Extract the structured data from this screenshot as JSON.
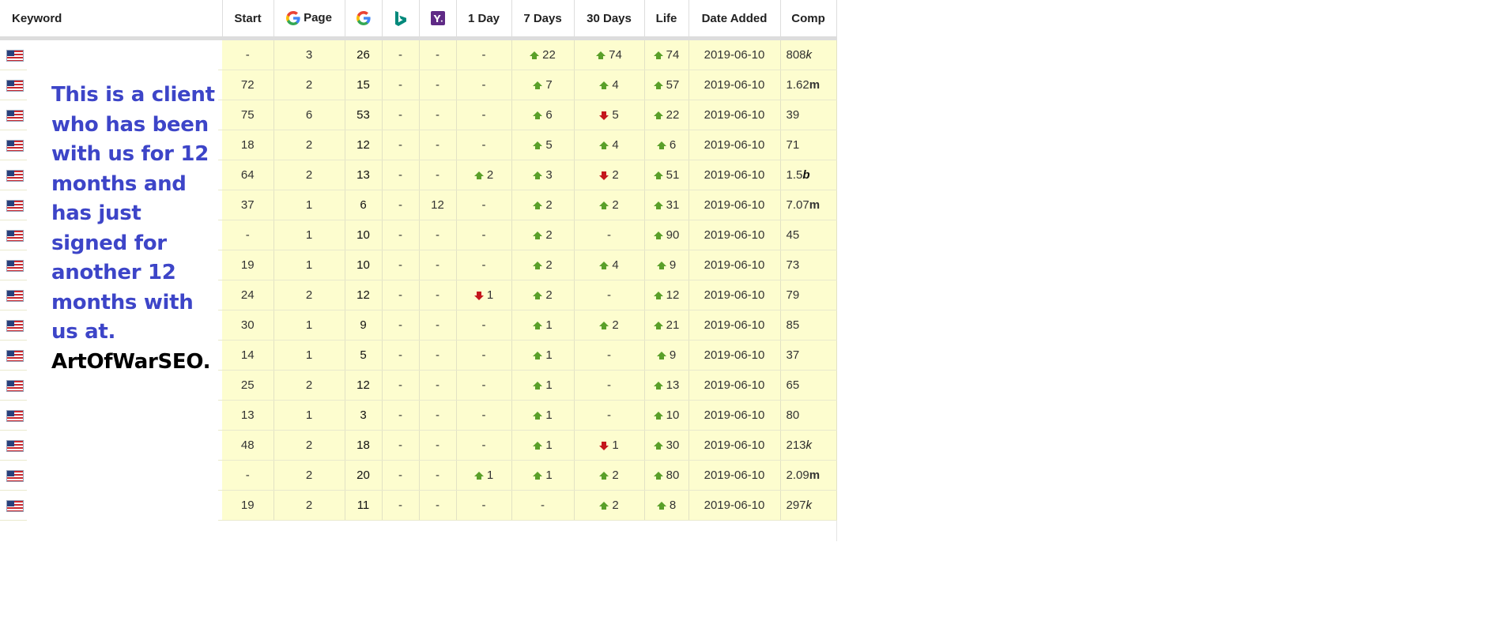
{
  "header": {
    "keyword": "Keyword",
    "start": "Start",
    "page": "Page",
    "day1": "1 Day",
    "days7": "7 Days",
    "days30": "30 Days",
    "life": "Life",
    "date_added": "Date Added",
    "comp": "Comp",
    "google_icon": "google-icon",
    "bing_icon": "bing-icon",
    "yahoo_icon": "yahoo-icon"
  },
  "colors": {
    "row_bg": "#fdfdcf",
    "up_arrow": "#5aa029",
    "down_arrow": "#c4161c",
    "note_text": "#3d45c8"
  },
  "rows": [
    {
      "start": "-",
      "page": "3",
      "google": "26",
      "bing": "-",
      "yahoo": "-",
      "d1": "",
      "d1_dir": "",
      "d7": "22",
      "d7_dir": "up",
      "d30": "74",
      "d30_dir": "up",
      "life": "74",
      "life_dir": "up",
      "date": "2019-06-10",
      "comp": "808",
      "comp_suffix": "k"
    },
    {
      "start": "72",
      "page": "2",
      "google": "15",
      "bing": "-",
      "yahoo": "-",
      "d1": "",
      "d1_dir": "",
      "d7": "7",
      "d7_dir": "up",
      "d30": "4",
      "d30_dir": "up",
      "life": "57",
      "life_dir": "up",
      "date": "2019-06-10",
      "comp": "1.62",
      "comp_suffix": "m"
    },
    {
      "start": "75",
      "page": "6",
      "google": "53",
      "bing": "-",
      "yahoo": "-",
      "d1": "",
      "d1_dir": "",
      "d7": "6",
      "d7_dir": "up",
      "d30": "5",
      "d30_dir": "down",
      "life": "22",
      "life_dir": "up",
      "date": "2019-06-10",
      "comp": "39",
      "comp_suffix": ""
    },
    {
      "start": "18",
      "page": "2",
      "google": "12",
      "bing": "-",
      "yahoo": "-",
      "d1": "",
      "d1_dir": "",
      "d7": "5",
      "d7_dir": "up",
      "d30": "4",
      "d30_dir": "up",
      "life": "6",
      "life_dir": "up",
      "date": "2019-06-10",
      "comp": "71",
      "comp_suffix": ""
    },
    {
      "start": "64",
      "page": "2",
      "google": "13",
      "bing": "-",
      "yahoo": "-",
      "d1": "2",
      "d1_dir": "up",
      "d7": "3",
      "d7_dir": "up",
      "d30": "2",
      "d30_dir": "down",
      "life": "51",
      "life_dir": "up",
      "date": "2019-06-10",
      "comp": "1.5",
      "comp_suffix": "b"
    },
    {
      "start": "37",
      "page": "1",
      "google": "6",
      "bing": "-",
      "yahoo": "12",
      "d1": "",
      "d1_dir": "",
      "d7": "2",
      "d7_dir": "up",
      "d30": "2",
      "d30_dir": "up",
      "life": "31",
      "life_dir": "up",
      "date": "2019-06-10",
      "comp": "7.07",
      "comp_suffix": "m"
    },
    {
      "start": "-",
      "page": "1",
      "google": "10",
      "bing": "-",
      "yahoo": "-",
      "d1": "",
      "d1_dir": "",
      "d7": "2",
      "d7_dir": "up",
      "d30": "",
      "d30_dir": "",
      "life": "90",
      "life_dir": "up",
      "date": "2019-06-10",
      "comp": "45",
      "comp_suffix": ""
    },
    {
      "start": "19",
      "page": "1",
      "google": "10",
      "bing": "-",
      "yahoo": "-",
      "d1": "",
      "d1_dir": "",
      "d7": "2",
      "d7_dir": "up",
      "d30": "4",
      "d30_dir": "up",
      "life": "9",
      "life_dir": "up",
      "date": "2019-06-10",
      "comp": "73",
      "comp_suffix": ""
    },
    {
      "start": "24",
      "page": "2",
      "google": "12",
      "bing": "-",
      "yahoo": "-",
      "d1": "1",
      "d1_dir": "down",
      "d7": "2",
      "d7_dir": "up",
      "d30": "",
      "d30_dir": "",
      "life": "12",
      "life_dir": "up",
      "date": "2019-06-10",
      "comp": "79",
      "comp_suffix": ""
    },
    {
      "start": "30",
      "page": "1",
      "google": "9",
      "bing": "-",
      "yahoo": "-",
      "d1": "",
      "d1_dir": "",
      "d7": "1",
      "d7_dir": "up",
      "d30": "2",
      "d30_dir": "up",
      "life": "21",
      "life_dir": "up",
      "date": "2019-06-10",
      "comp": "85",
      "comp_suffix": ""
    },
    {
      "start": "14",
      "page": "1",
      "google": "5",
      "bing": "-",
      "yahoo": "-",
      "d1": "",
      "d1_dir": "",
      "d7": "1",
      "d7_dir": "up",
      "d30": "",
      "d30_dir": "",
      "life": "9",
      "life_dir": "up",
      "date": "2019-06-10",
      "comp": "37",
      "comp_suffix": ""
    },
    {
      "start": "25",
      "page": "2",
      "google": "12",
      "bing": "-",
      "yahoo": "-",
      "d1": "",
      "d1_dir": "",
      "d7": "1",
      "d7_dir": "up",
      "d30": "",
      "d30_dir": "",
      "life": "13",
      "life_dir": "up",
      "date": "2019-06-10",
      "comp": "65",
      "comp_suffix": ""
    },
    {
      "start": "13",
      "page": "1",
      "google": "3",
      "bing": "-",
      "yahoo": "-",
      "d1": "",
      "d1_dir": "",
      "d7": "1",
      "d7_dir": "up",
      "d30": "",
      "d30_dir": "",
      "life": "10",
      "life_dir": "up",
      "date": "2019-06-10",
      "comp": "80",
      "comp_suffix": ""
    },
    {
      "start": "48",
      "page": "2",
      "google": "18",
      "bing": "-",
      "yahoo": "-",
      "d1": "",
      "d1_dir": "",
      "d7": "1",
      "d7_dir": "up",
      "d30": "1",
      "d30_dir": "down",
      "life": "30",
      "life_dir": "up",
      "date": "2019-06-10",
      "comp": "213",
      "comp_suffix": "k"
    },
    {
      "start": "-",
      "page": "2",
      "google": "20",
      "bing": "-",
      "yahoo": "-",
      "d1": "1",
      "d1_dir": "up",
      "d7": "1",
      "d7_dir": "up",
      "d30": "2",
      "d30_dir": "up",
      "life": "80",
      "life_dir": "up",
      "date": "2019-06-10",
      "comp": "2.09",
      "comp_suffix": "m"
    },
    {
      "start": "19",
      "page": "2",
      "google": "11",
      "bing": "-",
      "yahoo": "-",
      "d1": "",
      "d1_dir": "",
      "d7": "",
      "d7_dir": "",
      "d30": "2",
      "d30_dir": "up",
      "life": "8",
      "life_dir": "up",
      "date": "2019-06-10",
      "comp": "297",
      "comp_suffix": "k"
    }
  ],
  "overlay": {
    "message": "This is a client who has been with us for 12 months and has just signed for another 12 months with us at.",
    "brand": "ArtOfWarSEO."
  }
}
